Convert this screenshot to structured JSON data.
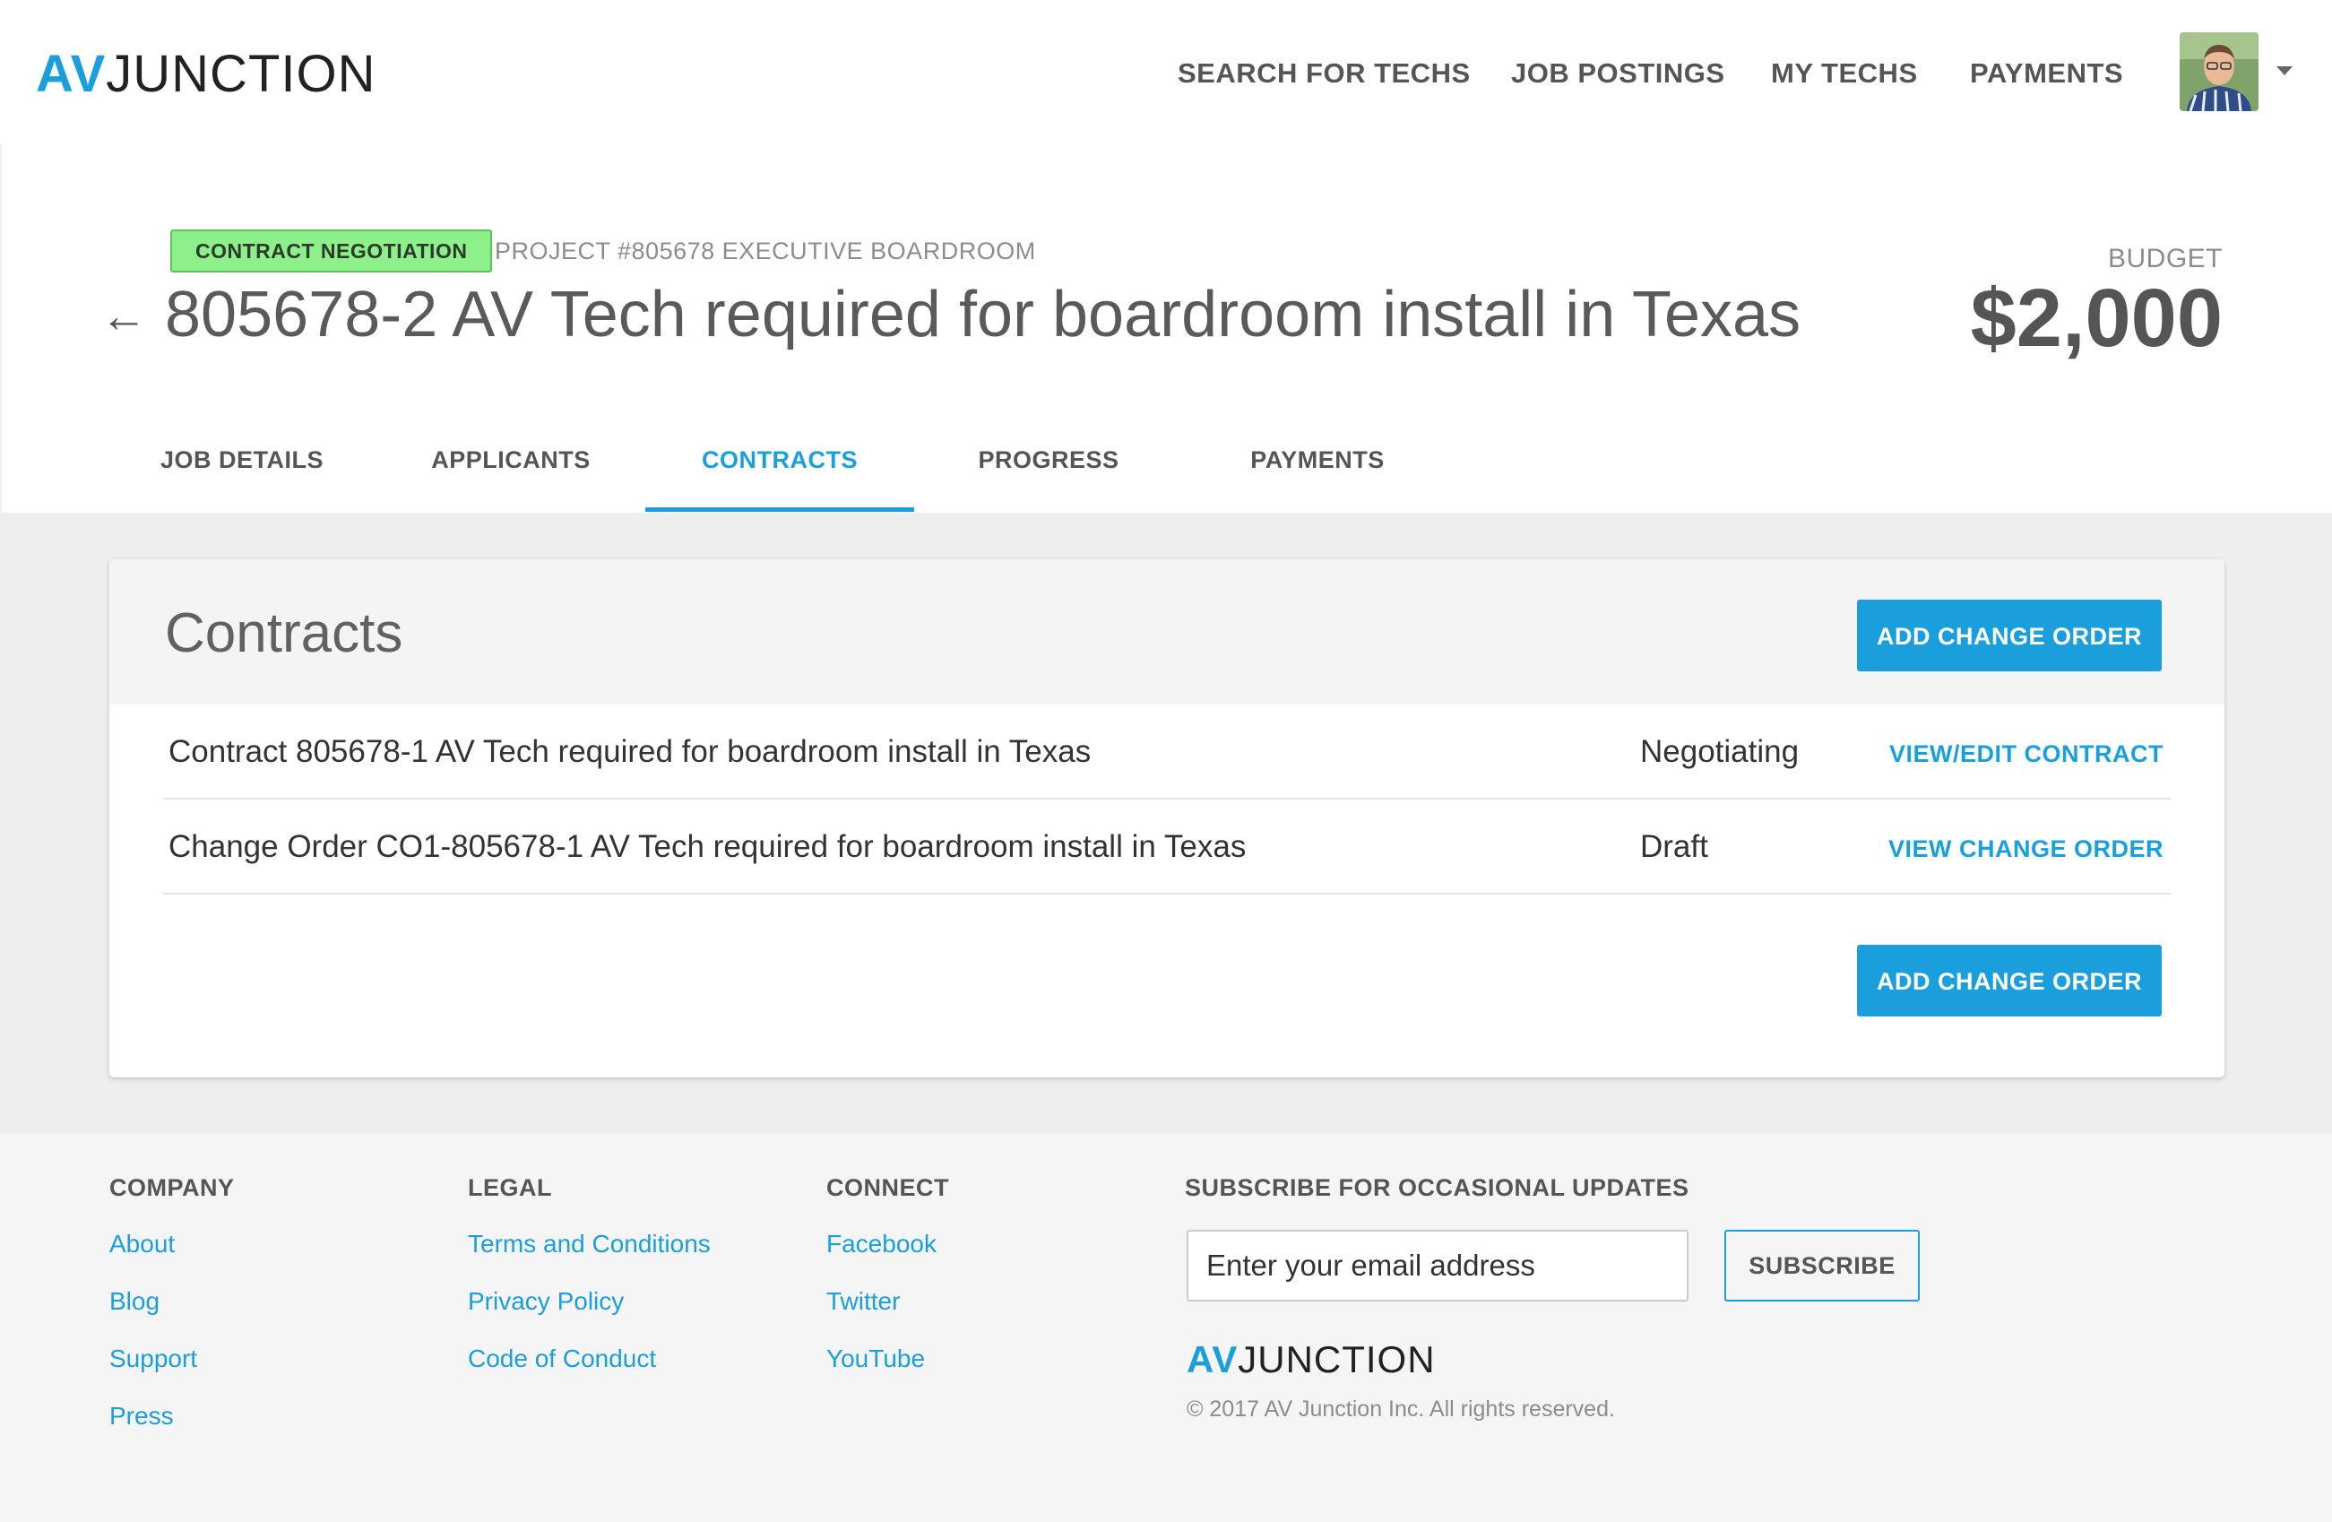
{
  "brand": {
    "av": "AV",
    "junction": "JUNCTION",
    "accent_color": "#1a9fdc"
  },
  "nav": {
    "search_for_techs": "SEARCH FOR TECHS",
    "job_postings": "JOB POSTINGS",
    "my_techs": "MY TECHS",
    "payments": "PAYMENTS",
    "avatar_icon": "user-avatar-photo",
    "menu_icon": "caret-down-icon"
  },
  "project": {
    "status_badge": "CONTRACT NEGOTIATION",
    "status_color": "#8ef08a",
    "project_label": "PROJECT #805678 EXECUTIVE BOARDROOM",
    "back_icon": "arrow-left-icon",
    "back_arrow": "←",
    "title": "805678-2 AV Tech required for boardroom install in Texas",
    "budget_label": "BUDGET",
    "budget_value": "$2,000"
  },
  "tabs": [
    {
      "label": "JOB DETAILS",
      "active": false
    },
    {
      "label": "APPLICANTS",
      "active": false
    },
    {
      "label": "CONTRACTS",
      "active": true
    },
    {
      "label": "PROGRESS",
      "active": false
    },
    {
      "label": "PAYMENTS",
      "active": false
    }
  ],
  "contracts": {
    "heading": "Contracts",
    "add_change_order_label": "ADD CHANGE ORDER",
    "rows": [
      {
        "title": "Contract 805678-1 AV Tech required for boardroom install in Texas",
        "status": "Negotiating",
        "action": "VIEW/EDIT CONTRACT"
      },
      {
        "title": "Change Order CO1-805678-1 AV Tech required for boardroom install in Texas",
        "status": "Draft",
        "action": "VIEW CHANGE ORDER"
      }
    ]
  },
  "footer": {
    "company": {
      "heading": "COMPANY",
      "links": [
        "About",
        "Blog",
        "Support",
        "Press"
      ]
    },
    "legal": {
      "heading": "LEGAL",
      "links": [
        "Terms and Conditions",
        "Privacy Policy",
        "Code of Conduct"
      ]
    },
    "connect": {
      "heading": "CONNECT",
      "links": [
        "Facebook",
        "Twitter",
        "YouTube"
      ]
    },
    "subscribe": {
      "heading": "SUBSCRIBE FOR OCCASIONAL UPDATES",
      "placeholder": "Enter your email address",
      "button": "SUBSCRIBE"
    },
    "copyright": "© 2017 AV Junction Inc. All rights reserved."
  }
}
